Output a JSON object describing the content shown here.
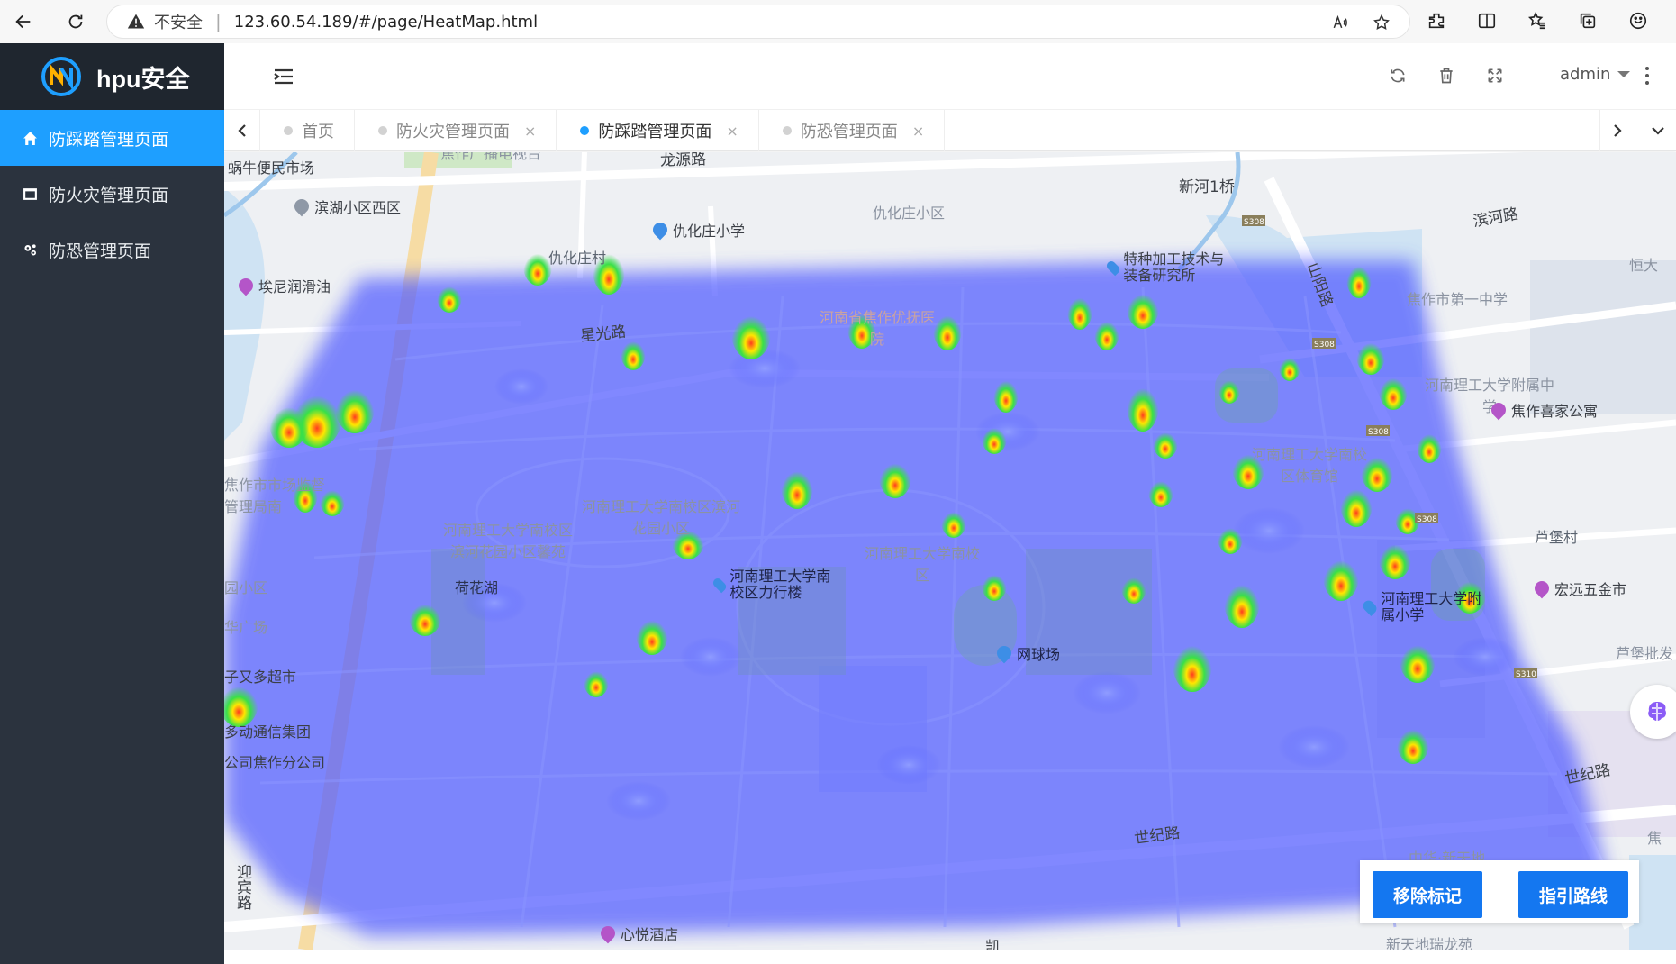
{
  "browser": {
    "insecure_label": "不安全",
    "url": "123.60.54.189/#/page/HeatMap.html"
  },
  "sidebar": {
    "logo_text": "hpu安全",
    "items": [
      {
        "label": "防踩踏管理页面",
        "active": true,
        "icon": "home-icon"
      },
      {
        "label": "防火灾管理页面",
        "active": false,
        "icon": "window-icon"
      },
      {
        "label": "防恐管理页面",
        "active": false,
        "icon": "gears-icon"
      }
    ]
  },
  "header": {
    "user": "admin"
  },
  "tabs": [
    {
      "label": "首页",
      "closable": false,
      "active": false
    },
    {
      "label": "防火灾管理页面",
      "closable": true,
      "active": false
    },
    {
      "label": "防踩踏管理页面",
      "closable": true,
      "active": true
    },
    {
      "label": "防恐管理页面",
      "closable": true,
      "active": false
    }
  ],
  "tab_close_glyph": "×",
  "map": {
    "roads": [
      "龙源路",
      "新河1桥",
      "滨河路",
      "山阳路",
      "星光路",
      "世纪路",
      "世纪路",
      "迎宾路",
      "凯"
    ],
    "labels": {
      "l1": "蜗牛便民市场",
      "l2": "焦作广播电视台",
      "l3": "仇化庄小区",
      "l4": "仇化庄村",
      "l5": "河南省焦作优抚医院",
      "l6": "恒大",
      "l7": "焦作市第一中学",
      "l8": "河南理工大学附属中学",
      "l9": "焦作市市场监督管理局南",
      "l10": "河南理工大学南校区滨河花园小区",
      "l11": "河南理工大学南校区滨河花园小区馨苑",
      "l12": "河南理工大学南校区",
      "l13": "河南理工大学南校区体育馆",
      "l14": "芦堡村",
      "l15": "园小区",
      "l16": "华广场",
      "l17": "芦堡批发",
      "l18": "中华·新天地",
      "l19": "新天地瑞龙苑",
      "l20": "焦"
    },
    "pois": {
      "p1": "滨湖小区西区",
      "p2": "仇化庄小学",
      "p3": "埃尼润滑油",
      "p4": "特种加工技术与装备研究所",
      "p5": "焦作喜家公寓",
      "p6": "子又多超市",
      "p7": "多动通信集团",
      "p8": "公司焦作分公司",
      "p9": "荷花湖",
      "p10": "河南理工大学南校区力行楼",
      "p11": "网球场",
      "p12": "河南理工大学附属小学",
      "p13": "宏远五金市",
      "p14": "心悦酒店"
    },
    "road_shields": [
      "S308",
      "S308",
      "S308",
      "S308",
      "S310"
    ]
  },
  "actions": {
    "remove_marker": "移除标记",
    "guide_route": "指引路线"
  },
  "colors": {
    "sidebar_bg": "#2b333e",
    "active_blue": "#1e9fff",
    "button_blue": "#1477f0",
    "heat_base": "#5560ff"
  }
}
